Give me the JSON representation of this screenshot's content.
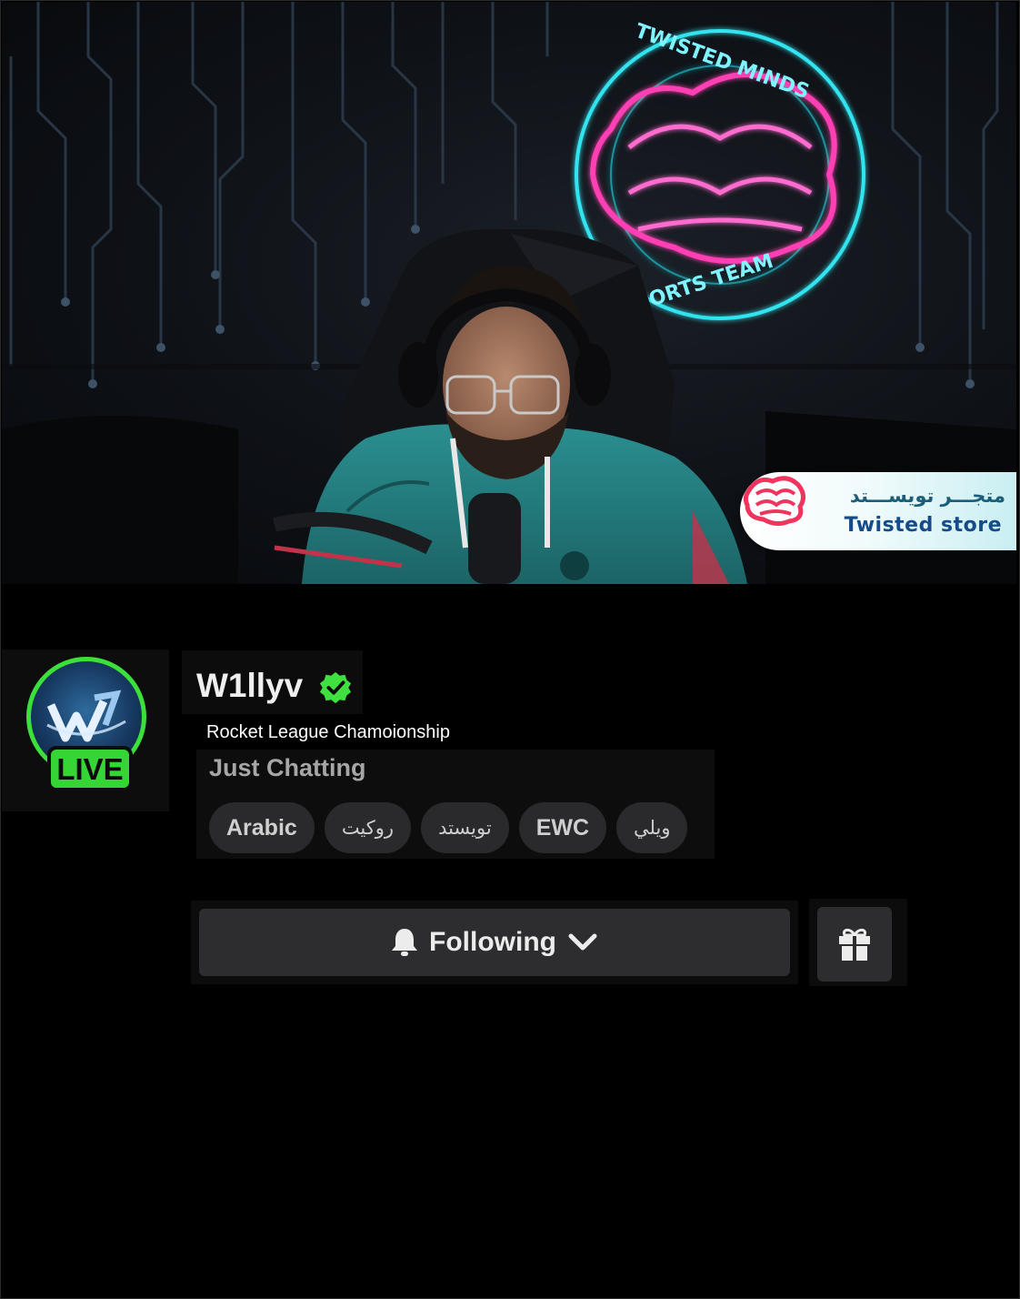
{
  "video": {
    "neon_sign": {
      "top_text": "TWISTED MINDS",
      "bottom_text": "ESPORTS TEAM"
    }
  },
  "store_banner": {
    "arabic_label": "متجـــر تويســـتد",
    "english_label": "Twisted  store"
  },
  "channel": {
    "name": "W1llyv",
    "verified": true,
    "live_label": "LIVE",
    "stream_title": "Rocket League Chamoionship",
    "category": "Just Chatting",
    "tags": [
      "Arabic",
      "روكيت",
      "تويستد",
      "EWC",
      "ويلي"
    ]
  },
  "actions": {
    "follow_label": "Following",
    "follow_icon": "bell-icon",
    "dropdown_icon": "chevron-down-icon",
    "gift_icon": "gift-icon"
  },
  "colors": {
    "live_green": "#36d536",
    "verified_green": "#3fe03f",
    "button_bg": "#2d2d30",
    "neon_pink": "#ff3fb4",
    "neon_cyan": "#33e4f0"
  }
}
